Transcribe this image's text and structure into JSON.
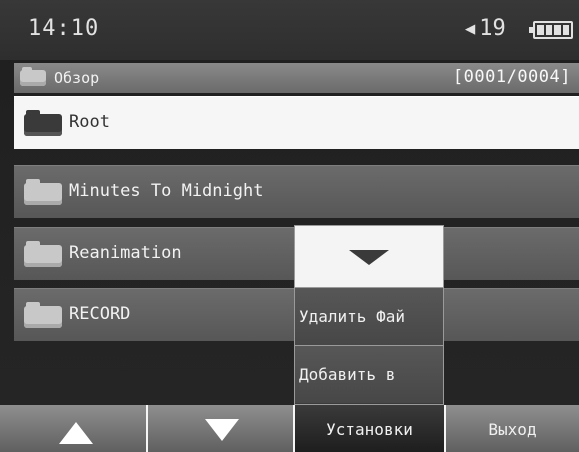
{
  "status": {
    "time": "14:10",
    "volume": "19",
    "volume_icon": "speaker-icon",
    "battery_icon": "battery-icon"
  },
  "browser": {
    "title": "Обзор",
    "counter": "[0001/0004]",
    "items": [
      {
        "label": "Root",
        "selected": true
      },
      {
        "label": "Minutes To Midnight",
        "selected": false
      },
      {
        "label": "Reanimation",
        "selected": false
      },
      {
        "label": "RECORD",
        "selected": false
      }
    ]
  },
  "popup": {
    "arrow_icon": "triangle-down-icon",
    "items": [
      "Удалить Фай",
      "Добавить в "
    ]
  },
  "softkeys": {
    "up_icon": "arrow-up-icon",
    "down_icon": "arrow-down-icon",
    "settings": "Установки",
    "exit": "Выход"
  }
}
